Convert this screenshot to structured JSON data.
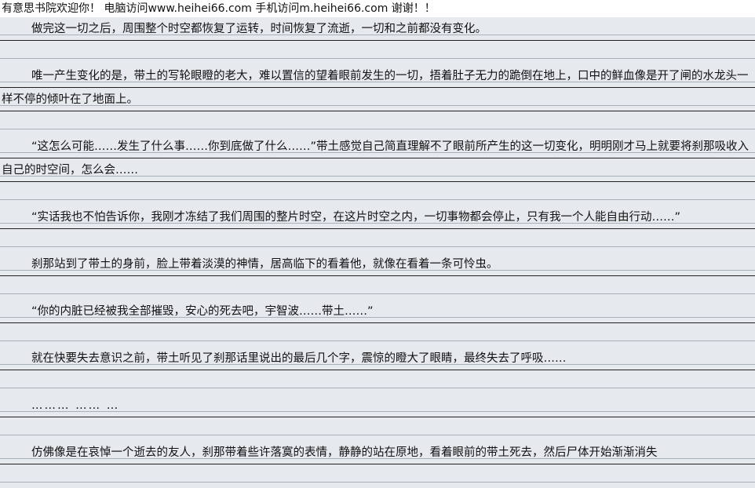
{
  "header": {
    "text": "有意思书院欢迎你！ 电脑访问www.heihei66.com  手机访问m.heihei66.com  谢谢！！"
  },
  "paragraphs": [
    "做完这一切之后，周围整个时空都恢复了运转，时间恢复了流逝，一切和之前都没有变化。",
    "唯一产生变化的是，带土的写轮眼瞪的老大，难以置信的望着眼前发生的一切，捂着肚子无力的跪倒在地上，口中的鲜血像是开了闸的水龙头一样不停的倾叶在了地面上。",
    "“这怎么可能……发生了什么事……你到底做了什么……”带土感觉自己简直理解不了眼前所产生的这一切变化，明明刚才马上就要将刹那吸收入自己的时空间，怎么会……",
    "“实话我也不怕告诉你，我刚才冻结了我们周围的整片时空，在这片时空之内，一切事物都会停止，只有我一个人能自由行动……”",
    "刹那站到了带土的身前，脸上带着淡漠的神情，居高临下的看着他，就像在看着一条可怜虫。",
    "“你的内脏已经被我全部摧毁，安心的死去吧，宇智波……带土……”",
    "就在快要失去意识之前，带土听见了刹那话里说出的最后几个字，震惊的瞪大了眼睛，最终失去了呼吸……",
    "……… …… …",
    "仿佛像是在哀悼一个逝去的友人，刹那带着些许落寞的表情，静静的站在原地，看着眼前的带土死去，然后尸体开始渐渐消失"
  ]
}
